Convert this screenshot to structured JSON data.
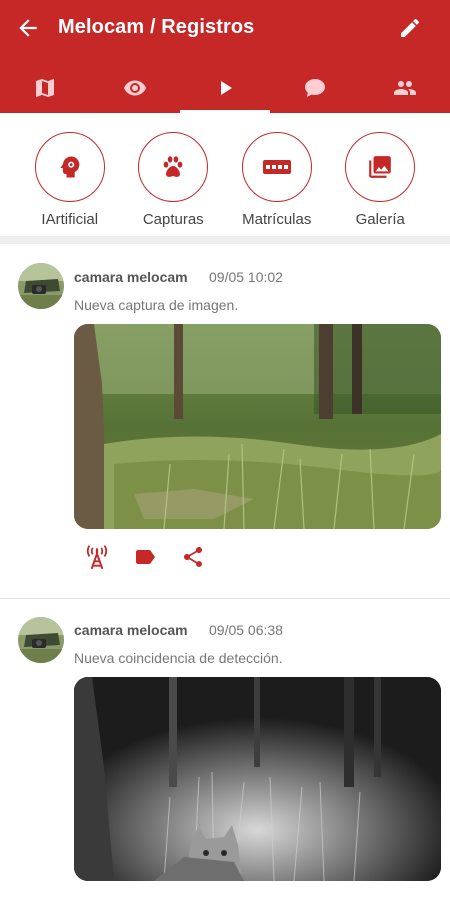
{
  "header": {
    "title": "Melocam / Registros",
    "back_icon": "arrow-back-icon",
    "edit_icon": "pencil-icon",
    "background": "#c62828"
  },
  "tabs": [
    {
      "icon": "map-icon",
      "active": false
    },
    {
      "icon": "eye-icon",
      "active": false
    },
    {
      "icon": "play-icon",
      "active": true
    },
    {
      "icon": "chat-bubble-icon",
      "active": false
    },
    {
      "icon": "people-icon",
      "active": false
    }
  ],
  "quick_actions": [
    {
      "label": "IArtificial",
      "icon": "brain-gear-icon"
    },
    {
      "label": "Capturas",
      "icon": "paw-print-icon"
    },
    {
      "label": "Matrículas",
      "icon": "license-plate-icon"
    },
    {
      "label": "Galería",
      "icon": "photo-gallery-icon"
    }
  ],
  "posts": [
    {
      "author": "camara melocam",
      "time": "09/05 10:02",
      "text": "Nueva captura de imagen.",
      "image": "forest-daylight-photo",
      "actions": [
        "antenna-icon",
        "tag-icon",
        "share-icon"
      ]
    },
    {
      "author": "camara melocam",
      "time": "09/05 06:38",
      "text": "Nueva coincidencia de detección.",
      "image": "night-infrared-cat-photo"
    }
  ],
  "accent_color": "#c62828"
}
